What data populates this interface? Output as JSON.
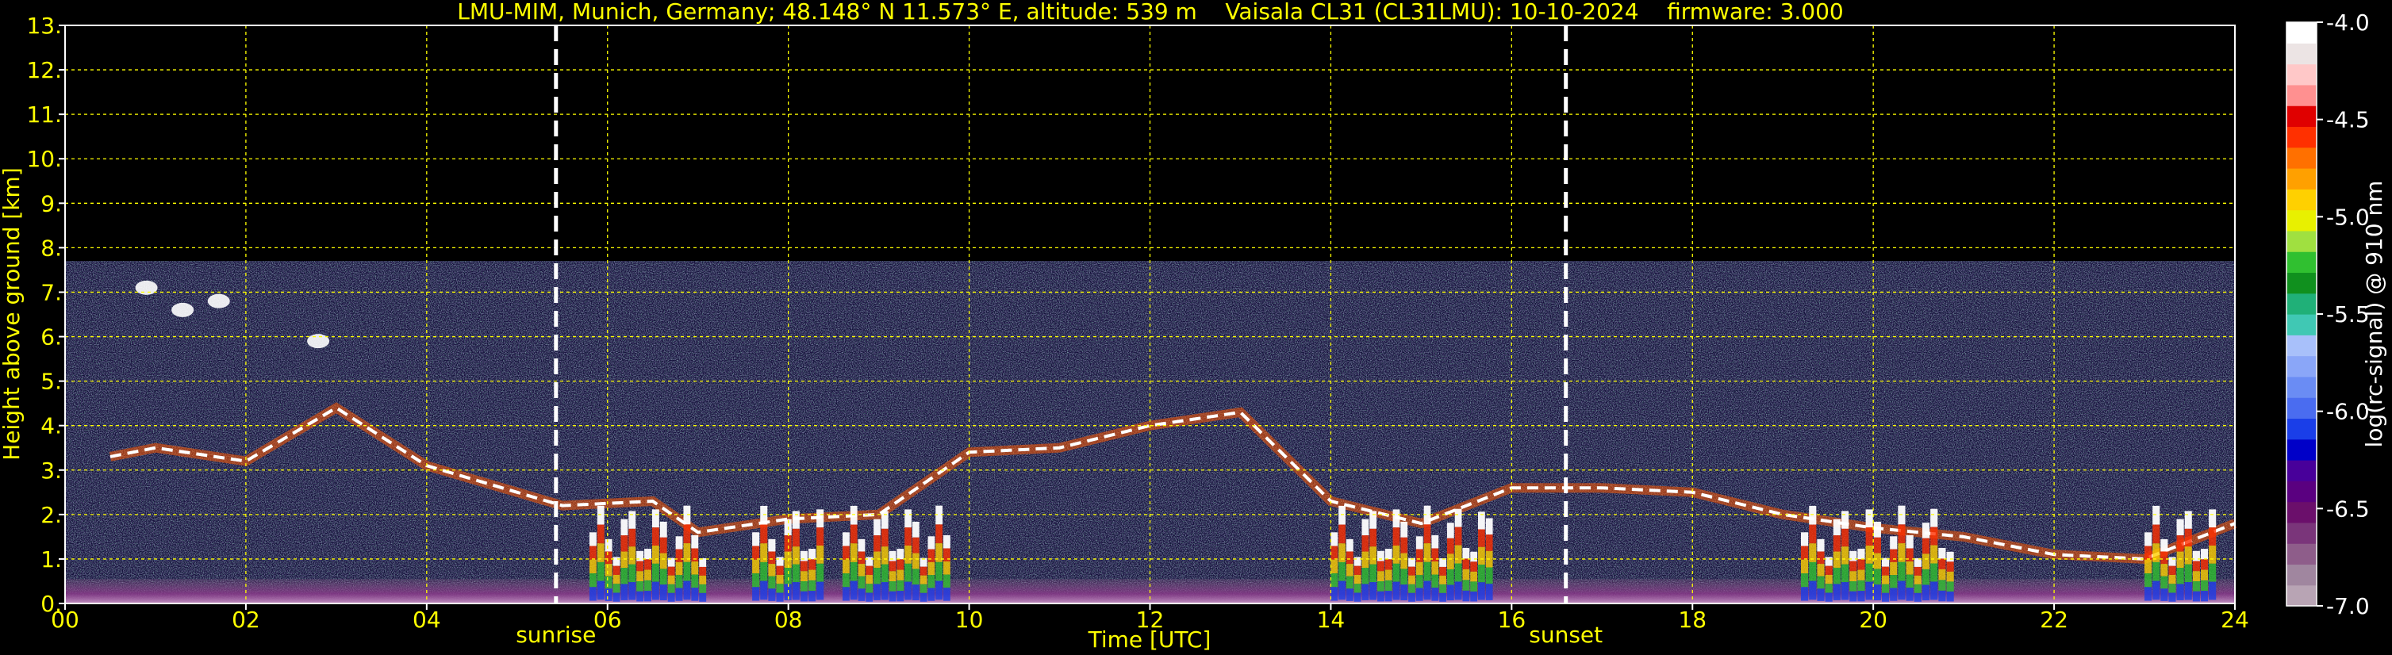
{
  "chart_data": {
    "type": "heatmap",
    "title": "LMU-MIM, Munich, Germany; 48.148° N 11.573° E, altitude: 539 m    Vaisala CL31 (CL31LMU): 10-10-2024    firmware: 3.000",
    "xlabel": "Time [UTC]",
    "ylabel": "Height above ground [km]",
    "xlim": [
      0,
      24
    ],
    "ylim": [
      0,
      13
    ],
    "x_ticks": [
      0,
      2,
      4,
      6,
      8,
      10,
      12,
      14,
      16,
      18,
      20,
      22,
      24
    ],
    "x_tick_labels": [
      "00",
      "02",
      "04",
      "06",
      "08",
      "10",
      "12",
      "14",
      "16",
      "18",
      "20",
      "22",
      "24"
    ],
    "y_ticks": [
      0,
      1,
      2,
      3,
      4,
      5,
      6,
      7,
      8,
      9,
      10,
      11,
      12,
      13
    ],
    "y_tick_labels": [
      "0.",
      "1.",
      "2.",
      "3.",
      "4.",
      "5.",
      "6.",
      "7.",
      "8.",
      "9.",
      "10.",
      "11.",
      "12.",
      "13."
    ],
    "grid": true,
    "signal_top_km": 7.7,
    "markers": [
      {
        "label": "sunrise",
        "time_utc": 5.43
      },
      {
        "label": "sunset",
        "time_utc": 16.6
      }
    ],
    "colorbar": {
      "label": "log(rc-signal) @ 910 nm",
      "range": [
        -7.0,
        -4.0
      ],
      "ticks": [
        -7.0,
        -6.5,
        -6.0,
        -5.5,
        -5.0,
        -4.5,
        -4.0
      ],
      "tick_labels": [
        "-7.0",
        "-6.5",
        "-6.0",
        "-5.5",
        "-5.0",
        "-4.5",
        "-4.0"
      ],
      "colors": [
        "#b8a4b4",
        "#a0869f",
        "#8e5d8a",
        "#7a357a",
        "#6b0f6b",
        "#5a0080",
        "#48009a",
        "#0000c8",
        "#1a3ee8",
        "#4a6cf0",
        "#6a8cf4",
        "#8aa6f8",
        "#a8c0fa",
        "#40c8b4",
        "#20b078",
        "#10901e",
        "#30c030",
        "#a0e040",
        "#e8f000",
        "#ffd000",
        "#ffa000",
        "#ff7000",
        "#ff3000",
        "#e00000",
        "#ff9090",
        "#ffc8c8",
        "#ece4e4",
        "#ffffff"
      ]
    },
    "series": [
      {
        "name": "cloud layer",
        "points": [
          [
            0.5,
            3.3
          ],
          [
            1.0,
            3.5
          ],
          [
            2.0,
            3.2
          ],
          [
            3.0,
            4.4
          ],
          [
            4.0,
            3.1
          ],
          [
            5.0,
            2.5
          ],
          [
            5.5,
            2.2
          ],
          [
            6.5,
            2.3
          ],
          [
            7.0,
            1.6
          ],
          [
            8.0,
            1.9
          ],
          [
            9.0,
            2.0
          ],
          [
            10.0,
            3.4
          ],
          [
            11.0,
            3.5
          ],
          [
            12.0,
            4.0
          ],
          [
            13.0,
            4.3
          ],
          [
            14.0,
            2.3
          ],
          [
            15.0,
            1.8
          ],
          [
            16.0,
            2.6
          ],
          [
            17.0,
            2.6
          ],
          [
            18.0,
            2.5
          ],
          [
            19.0,
            2.0
          ],
          [
            20.0,
            1.7
          ],
          [
            21.0,
            1.5
          ],
          [
            22.0,
            1.1
          ],
          [
            23.0,
            1.0
          ],
          [
            24.0,
            1.8
          ]
        ]
      },
      {
        "name": "high cloud",
        "points": [
          [
            0.9,
            7.1
          ],
          [
            1.3,
            6.6
          ],
          [
            1.7,
            6.8
          ],
          [
            2.8,
            5.9
          ]
        ]
      },
      {
        "name": "precipitation",
        "segments": [
          [
            5.8,
            7.1
          ],
          [
            7.6,
            8.4
          ],
          [
            8.6,
            9.8
          ],
          [
            14.0,
            15.8
          ],
          [
            19.2,
            20.9
          ],
          [
            23.0,
            23.8
          ]
        ]
      }
    ]
  }
}
